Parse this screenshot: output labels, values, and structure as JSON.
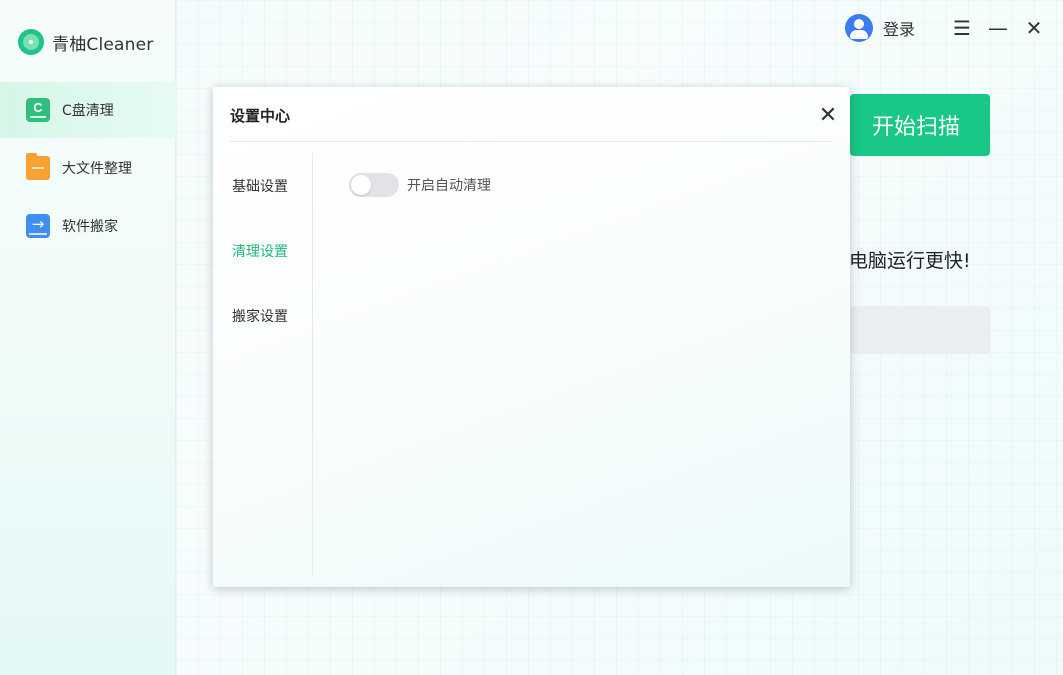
{
  "app": {
    "brand_name": "青柚Cleaner"
  },
  "sidebar": {
    "items": [
      {
        "label": "C盘清理",
        "icon": "c-drive-icon",
        "active": true
      },
      {
        "label": "大文件整理",
        "icon": "folder-icon",
        "active": false
      },
      {
        "label": "软件搬家",
        "icon": "move-icon",
        "active": false
      }
    ]
  },
  "titlebar": {
    "login_label": "登录",
    "menu_glyph": "☰",
    "minimize_glyph": "—",
    "close_glyph": "✕"
  },
  "main": {
    "scan_button_label": "开始扫描",
    "tagline": "电脑运行更快!"
  },
  "modal": {
    "title": "设置中心",
    "close_glyph": "✕",
    "nav": [
      {
        "label": "基础设置",
        "active": false
      },
      {
        "label": "清理设置",
        "active": true
      },
      {
        "label": "搬家设置",
        "active": false
      }
    ],
    "auto_clean": {
      "label": "开启自动清理",
      "enabled": false
    }
  },
  "colors": {
    "accent": "#19c787",
    "active_text": "#23b77a",
    "avatar": "#3b7cf2"
  }
}
